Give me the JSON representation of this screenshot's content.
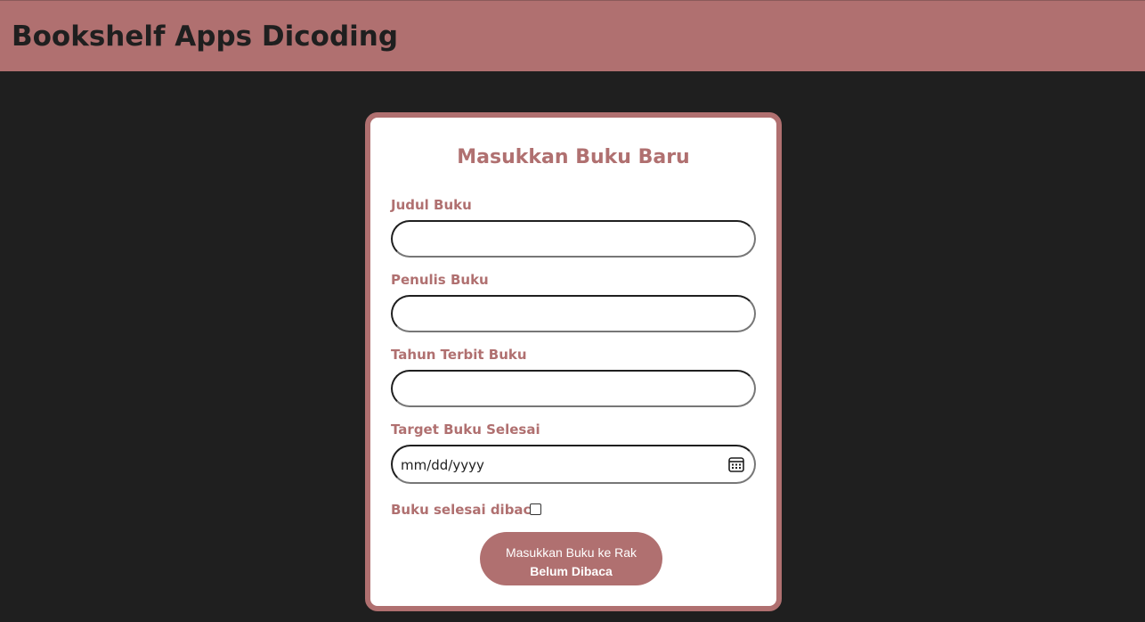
{
  "header": {
    "title": "Bookshelf Apps Dicoding"
  },
  "form": {
    "title": "Masukkan Buku Baru",
    "fields": {
      "title_label": "Judul Buku",
      "author_label": "Penulis Buku",
      "year_label": "Tahun Terbit Buku",
      "target_label": "Target Buku Selesai",
      "target_placeholder": "mm/dd/yyyy",
      "complete_label": "Buku selesai dibaca"
    },
    "complete_checked": false,
    "submit": {
      "line1": "Masukkan Buku ke Rak",
      "line2": "Belum Dibaca"
    },
    "icons": {
      "date": "calendar-icon"
    }
  },
  "colors": {
    "accent": "#b07070",
    "background": "#1f1f1f",
    "card": "#ffffff"
  }
}
